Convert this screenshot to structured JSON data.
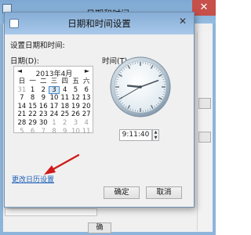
{
  "outer_window": {
    "title": "日期和时间",
    "close_glyph": "✕",
    "bottom_button": "确"
  },
  "dialog": {
    "title": "日期和时间设置",
    "close_glyph": "✕",
    "heading": "设置日期和时间:",
    "date_label": "日期(D):",
    "time_label": "时间(T):",
    "time_value": "9:11:40",
    "change_calendar_link": "更改日历设置",
    "ok_button": "确定",
    "cancel_button": "取消"
  },
  "calendar": {
    "month_title": "2013年4月",
    "prev_glyph": "◄",
    "next_glyph": "►",
    "weekdays": [
      "日",
      "一",
      "二",
      "三",
      "四",
      "五",
      "六"
    ],
    "weeks": [
      [
        "31",
        "1",
        "2",
        "3",
        "4",
        "5",
        "6"
      ],
      [
        "7",
        "8",
        "9",
        "10",
        "11",
        "12",
        "13"
      ],
      [
        "14",
        "15",
        "16",
        "17",
        "18",
        "19",
        "20"
      ],
      [
        "21",
        "22",
        "23",
        "24",
        "25",
        "26",
        "27"
      ],
      [
        "28",
        "29",
        "30",
        "1",
        "2",
        "3",
        "4"
      ],
      [
        "5",
        "6",
        "7",
        "8",
        "9",
        "10",
        "11"
      ]
    ],
    "selected_day": "3"
  },
  "clock": {
    "hour": 9,
    "minute": 11,
    "second": 40
  },
  "colors": {
    "accent": "#1d5fb7",
    "arrow": "#d01a1a",
    "title_bar": "#9cbfe3"
  }
}
